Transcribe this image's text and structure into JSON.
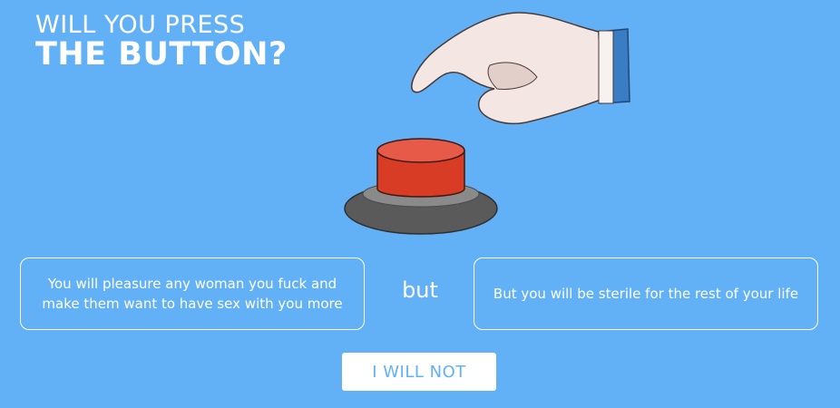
{
  "title": {
    "line1": "WILL YOU PRESS",
    "line2": "THE BUTTON?"
  },
  "options": {
    "benefit": "You will pleasure any woman you fuck and make them want to have sex with you more",
    "connector": "but",
    "drawback": "But you will be sterile for the rest of your life"
  },
  "actions": {
    "decline_label": "I WILL NOT"
  },
  "colors": {
    "background": "#62b1f6",
    "button_top": "#e84c36",
    "button_side": "#d93c25",
    "base_dark": "#5a5a5a",
    "base_ring": "#8a8a8a",
    "glove": "#f3e6e3",
    "cuff": "#3b7dc4"
  },
  "icons": {
    "hand": "pointing-hand-icon",
    "button": "red-button-icon"
  }
}
